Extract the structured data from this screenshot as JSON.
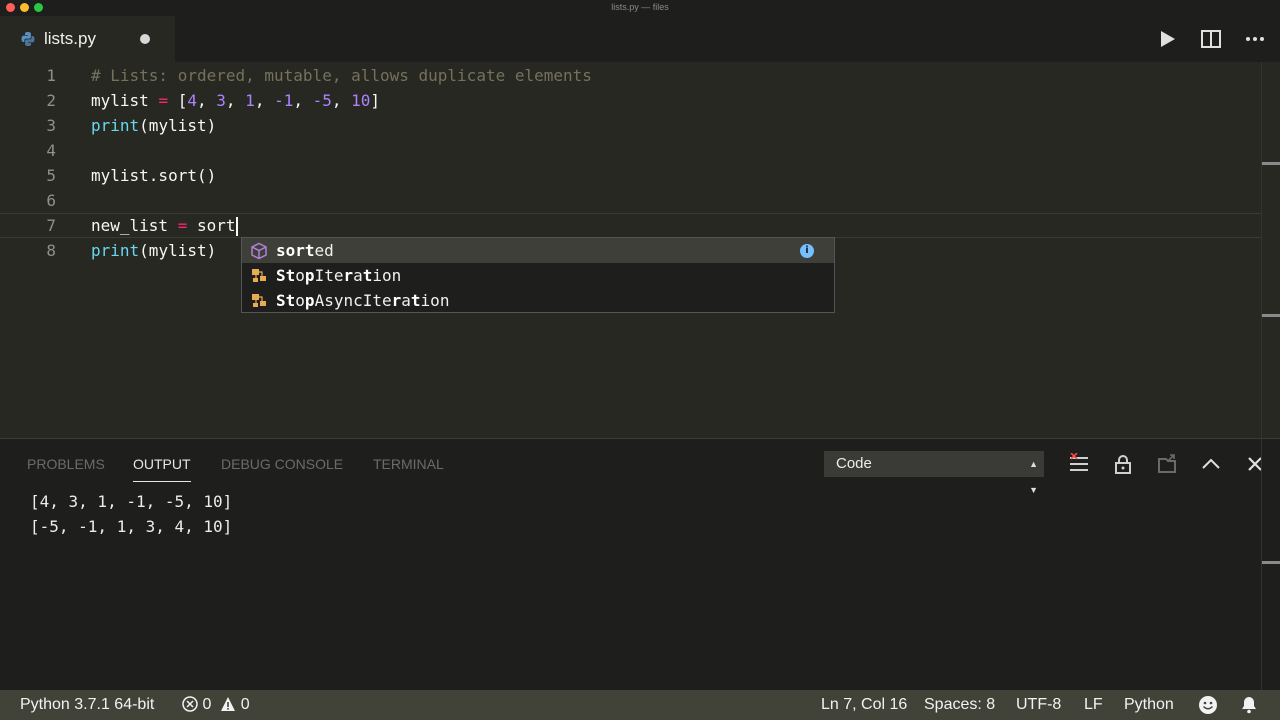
{
  "window": {
    "title": "lists.py — files"
  },
  "tab": {
    "filename": "lists.py",
    "language_icon": "python-icon"
  },
  "editor": {
    "lines": [
      {
        "n": "1"
      },
      {
        "n": "2"
      },
      {
        "n": "3"
      },
      {
        "n": "4"
      },
      {
        "n": "5"
      },
      {
        "n": "6"
      },
      {
        "n": "7"
      },
      {
        "n": "8"
      }
    ],
    "tokens": {
      "comment": "# Lists: ordered, mutable, allows duplicate elements",
      "mylist": "mylist",
      "eq": "=",
      "lb": "[",
      "n4": "4",
      "n3": "3",
      "n1": "1",
      "n_1": "-1",
      "n_5": "-5",
      "n10": "10",
      "rb": "]",
      "comma": ", ",
      "print": "print",
      "paren_mylist": "(mylist)",
      "sort_call": "mylist.sort()",
      "new_list": "new_list",
      "typed": "sort"
    }
  },
  "suggest": {
    "items": [
      {
        "match": "sort",
        "rest": "ed",
        "icon": "module-icon"
      },
      {
        "part1": "S",
        "part2": "t",
        "part3": "o",
        "part4": "p",
        "part5": "Ite",
        "part6": "r",
        "part7": "a",
        "part8": "t",
        "part9": "ion",
        "icon": "class-icon"
      },
      {
        "part1": "S",
        "part2": "t",
        "part3": "o",
        "part4": "p",
        "part5": "AsyncIte",
        "part6": "r",
        "part7": "a",
        "part8": "t",
        "part9": "ion",
        "icon": "class-icon"
      }
    ]
  },
  "panel": {
    "tabs": [
      "PROBLEMS",
      "OUTPUT",
      "DEBUG CONSOLE",
      "TERMINAL"
    ],
    "active_tab": "OUTPUT",
    "channel": "Code",
    "output": [
      "[4, 3, 1, -1, -5, 10]",
      "[-5, -1, 1, 3, 4, 10]"
    ]
  },
  "status": {
    "interpreter": "Python 3.7.1 64-bit",
    "errors": "0",
    "warnings": "0",
    "position": "Ln 7, Col 16",
    "spaces": "Spaces: 8",
    "encoding": "UTF-8",
    "eol": "LF",
    "language": "Python"
  },
  "colors": {
    "comment": "#75715e",
    "number": "#ae81ff",
    "operator": "#f92672",
    "builtin": "#66d9ef",
    "statusbar": "#414339"
  }
}
